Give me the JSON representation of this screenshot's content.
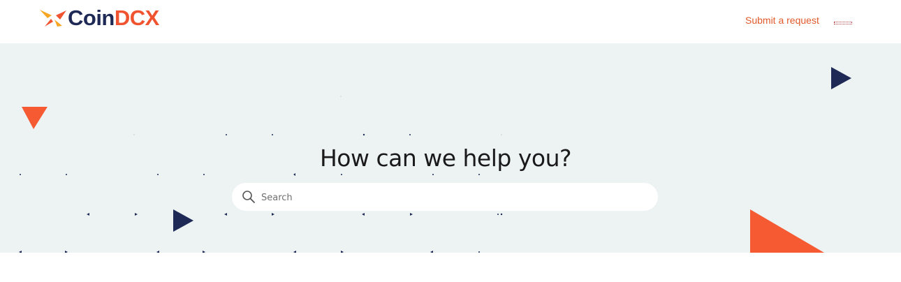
{
  "header": {
    "logo": {
      "brand_part1": "Coin",
      "brand_part2": "DCX"
    },
    "nav": {
      "submit_request_label": "Submit a request"
    }
  },
  "hero": {
    "title": "How can we help you?",
    "search": {
      "placeholder": "Search",
      "value": ""
    }
  },
  "colors": {
    "brand_navy": "#1e2a55",
    "brand_orange": "#f0532f",
    "link_orange": "#e05a2b",
    "hero_background": "#edf3f3",
    "logo_mark_yellow": "#f6a623"
  },
  "icons": [
    "coindcx-logo-mark-icon",
    "search-icon"
  ]
}
